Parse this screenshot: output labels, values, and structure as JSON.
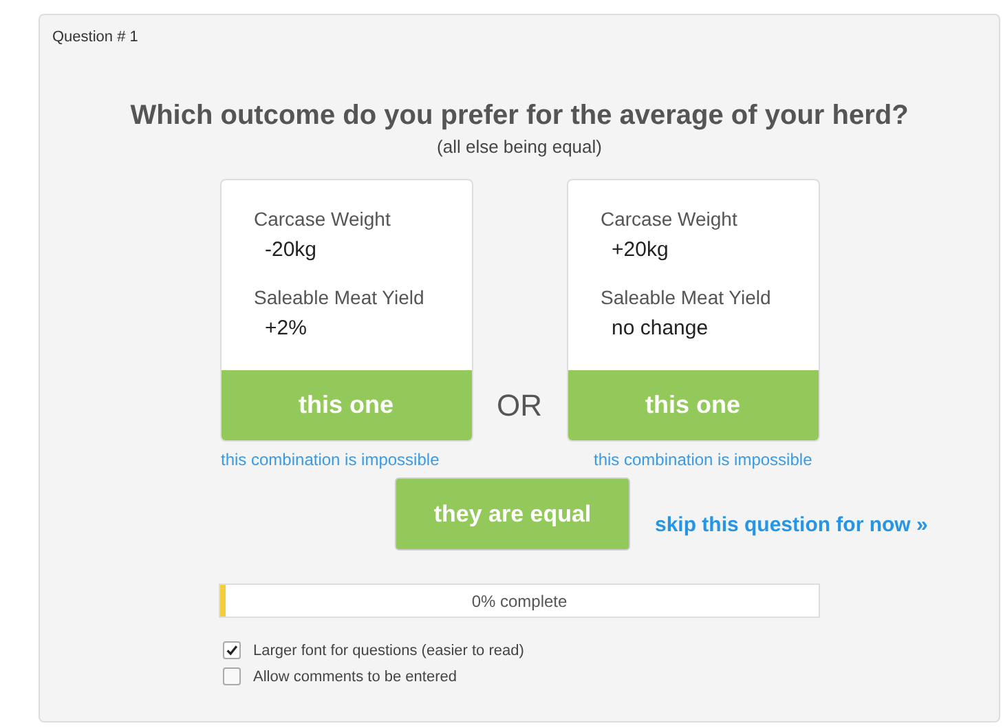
{
  "question_label": "Question # 1",
  "title": "Which outcome do you prefer for the average of your herd?",
  "subtitle": "(all else being equal)",
  "options": [
    {
      "attributes": [
        {
          "name": "Carcase Weight",
          "value": "-20kg"
        },
        {
          "name": "Saleable Meat Yield",
          "value": "+2%"
        }
      ],
      "choose_button": "this one",
      "impossible_link": "this combination is impossible"
    },
    {
      "attributes": [
        {
          "name": "Carcase Weight",
          "value": "+20kg"
        },
        {
          "name": "Saleable Meat Yield",
          "value": "no change"
        }
      ],
      "choose_button": "this one",
      "impossible_link": "this combination is impossible"
    }
  ],
  "separator": "OR",
  "equal_button": "they are equal",
  "skip_link": "skip this question for now »",
  "progress": {
    "level": 0.01,
    "label": "0% complete"
  },
  "options_checkboxes": [
    {
      "label": "Larger font for questions (easier to read)",
      "checked": true
    },
    {
      "label": "Allow comments to be entered",
      "checked": false
    }
  ]
}
